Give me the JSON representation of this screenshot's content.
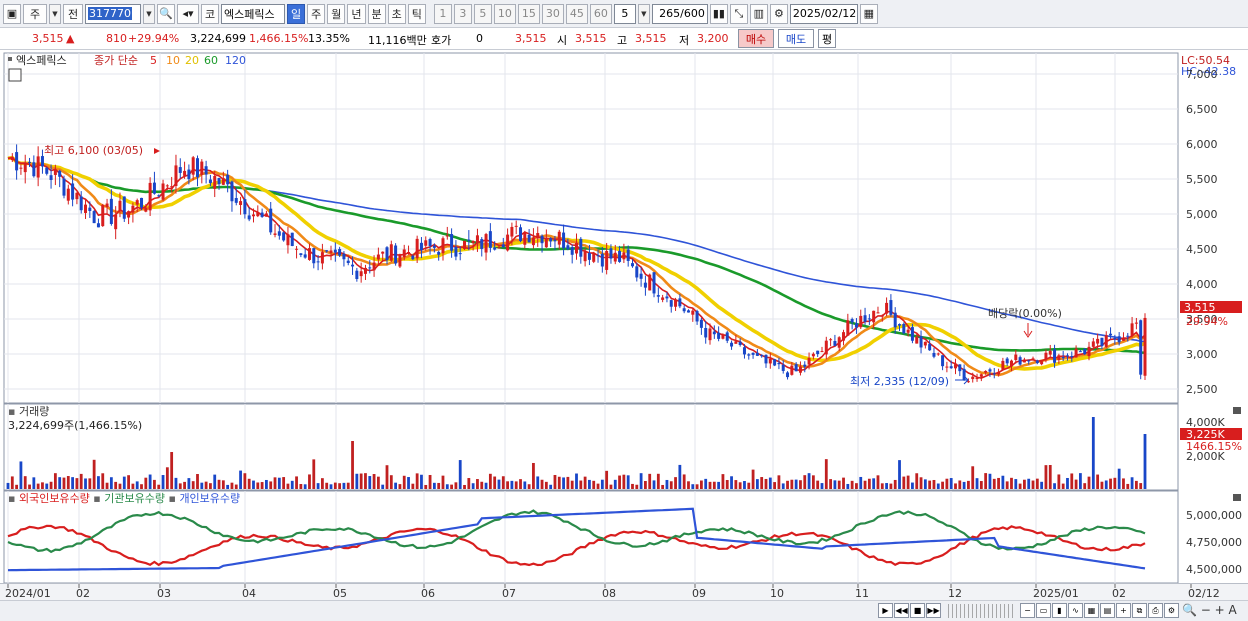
{
  "toolbar": {
    "market": "주",
    "prev": "전",
    "code": "317770",
    "stock_name": "엑스페릭스",
    "exchange": "코",
    "periods": [
      "일",
      "주",
      "월",
      "년",
      "분",
      "초",
      "틱"
    ],
    "active_period": "일",
    "intervals": [
      "1",
      "3",
      "5",
      "10",
      "15",
      "30",
      "45",
      "60"
    ],
    "interval_value": "5",
    "bar_count": "265",
    "bar_total": "/600",
    "date": "2025/02/12"
  },
  "quote": {
    "price": "3,515",
    "change": "810",
    "change_pct": "+29.94%",
    "volume": "3,224,699",
    "volume_ratio": "1,466.15%",
    "turnover": "13.35%",
    "amount": "11,116백만",
    "hoga_label": "호가",
    "hoga_value": "0",
    "last": "3,515",
    "open_label": "시",
    "open": "3,515",
    "high_label": "고",
    "high": "3,515",
    "low_label": "저",
    "low": "3,200",
    "buy_label": "매수",
    "sell_label": "매도",
    "avg_label": "평"
  },
  "price_panel": {
    "legend_name": "엑스페릭스",
    "legend_type": "종가 단순",
    "ma_labels": [
      "5",
      "10",
      "20",
      "60",
      "120"
    ],
    "ma_colors": [
      "#d81e1e",
      "#f08a18",
      "#f0d000",
      "#1a9a2a",
      "#2f54d8"
    ],
    "lc": "LC:50.54",
    "hc": "HC:-42.38",
    "high_note": "최고 6,100 (03/05)",
    "low_note": "최저 2,335 (12/09)",
    "dividend_note": "배당락(0.00%)",
    "price_tag": "3,515",
    "pct_tag": "29.94%",
    "y_ticks": [
      "7,000",
      "6,500",
      "6,000",
      "5,500",
      "5,000",
      "4,500",
      "4,000",
      "3,500",
      "3,000",
      "2,500"
    ]
  },
  "volume_panel": {
    "title": "거래량",
    "value": "3,224,699주(1,466.15%)",
    "y_ticks": [
      "4,000K",
      "2,000K"
    ],
    "vol_tag": "3,225K",
    "vol_pct_tag": "1466.15%"
  },
  "holdings_panel": {
    "series": [
      "외국인보유수량",
      "기관보유수량",
      "개인보유수량"
    ],
    "y_ticks": [
      "5,000,000",
      "4,750,000",
      "4,500,000"
    ]
  },
  "x_axis": {
    "labels": [
      "2024/01",
      "02",
      "03",
      "04",
      "05",
      "06",
      "07",
      "08",
      "09",
      "10",
      "11",
      "12",
      "2025/01",
      "02",
      "02/12"
    ]
  },
  "chart_data": {
    "type": "candlestick",
    "x": [
      "2024/01",
      "02",
      "03",
      "04",
      "05",
      "06",
      "07",
      "08",
      "09",
      "10",
      "11",
      "12",
      "2025/01",
      "02"
    ],
    "close_approx": [
      5800,
      5000,
      5600,
      4900,
      4100,
      4700,
      4600,
      4500,
      3200,
      2800,
      3600,
      2700,
      2950,
      3515
    ],
    "ylim": [
      2300,
      7300
    ],
    "high": {
      "value": 6100,
      "date": "03/05"
    },
    "low": {
      "value": 2335,
      "date": "12/09"
    },
    "last": 3515,
    "moving_averages": [
      "5",
      "10",
      "20",
      "60",
      "120"
    ]
  }
}
